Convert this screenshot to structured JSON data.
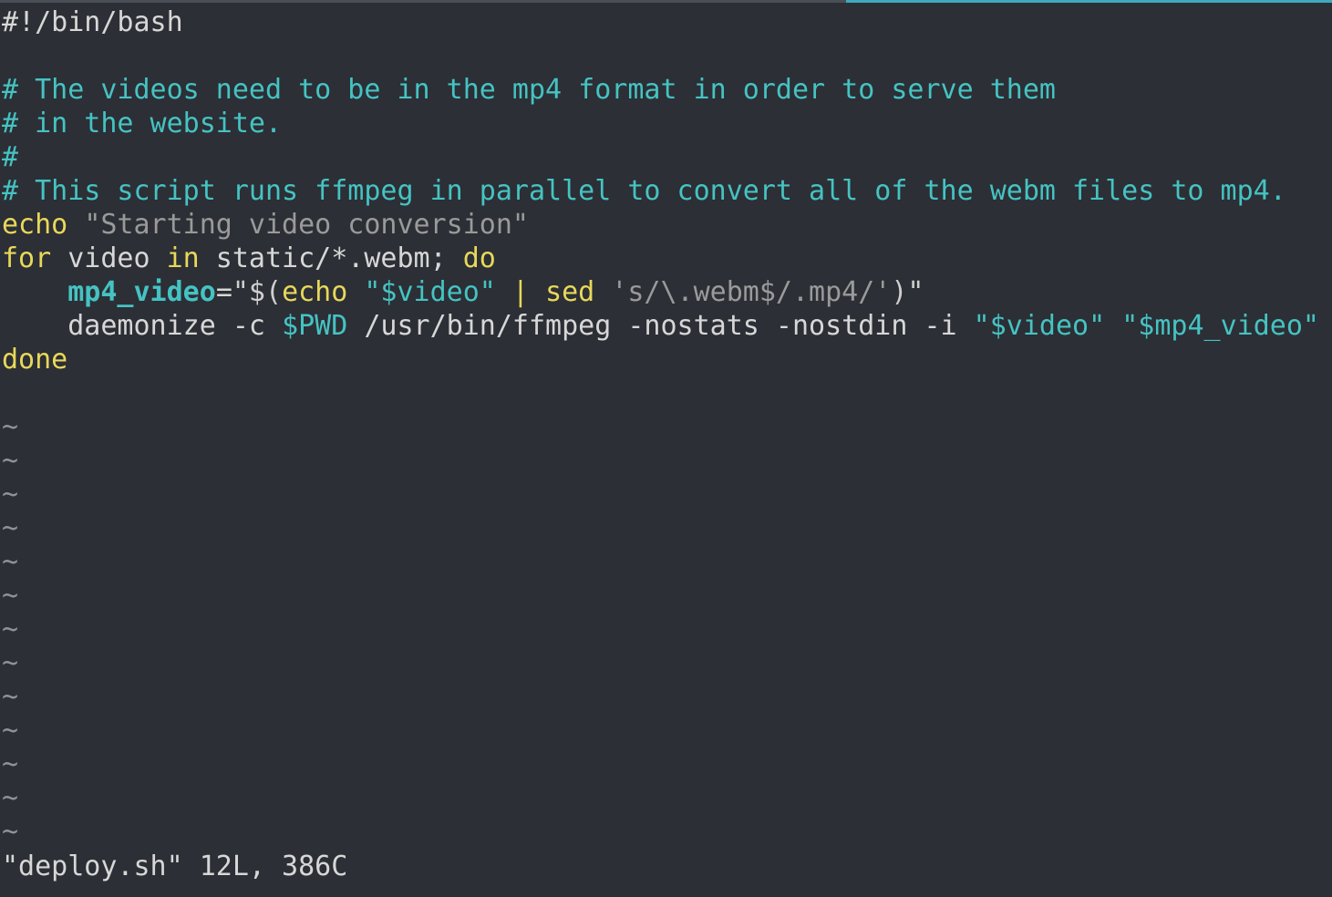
{
  "editor": {
    "file_status": "\"deploy.sh\" 12L, 386C",
    "tilde": "~",
    "empty_line_count_visible": 13
  },
  "code": {
    "line1": "#!/bin/bash",
    "line2": "",
    "line3": "# The videos need to be in the mp4 format in order to serve them",
    "line4": "# in the website.",
    "line5": "#",
    "line6": "# This script runs ffmpeg in parallel to convert all of the webm files to mp4.",
    "line7": {
      "kw_echo": "echo",
      "space": " ",
      "str": "\"Starting video conversion\""
    },
    "line8": {
      "kw_for": "for",
      "p1": " video ",
      "kw_in": "in",
      "p2": " static/*.webm; ",
      "kw_do": "do"
    },
    "line9": {
      "indent": "    ",
      "var": "mp4_video",
      "eq": "=",
      "q1": "\"$(",
      "kw_echo": "echo",
      "sp1": " ",
      "q2": "\"$video\"",
      "pipe": " | ",
      "kw_sed": "sed",
      "sp2": " ",
      "sedexpr": "'s/\\.webm$/.mp4/'",
      "q3": ")\""
    },
    "line10": {
      "indent": "    ",
      "cmd": "daemonize -c ",
      "pwd": "$PWD",
      "rest": " /usr/bin/ffmpeg -nostats -nostdin -i ",
      "q1": "\"$video\"",
      "sp": " ",
      "q2": "\"$mp4_video\""
    },
    "line11": {
      "kw_done": "done"
    }
  },
  "colors": {
    "background": "#2c2f35",
    "comment": "#45c3c3",
    "keyword": "#e8d85a",
    "string": "#9a9a9a",
    "text": "#d7d7d7",
    "tab_indicator": "#3fa9c0"
  }
}
